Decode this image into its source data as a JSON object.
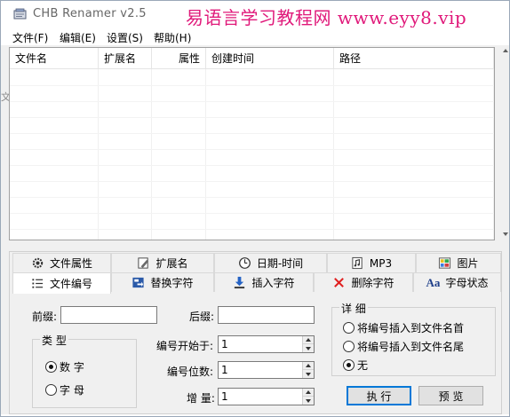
{
  "window": {
    "title": "CHB Renamer v2.5",
    "watermark": "易语言学习教程网 www.eyy8.vip"
  },
  "menu": [
    "文件(F)",
    "编辑(E)",
    "设置(S)",
    "帮助(H)"
  ],
  "list": {
    "columns": [
      "文件名",
      "扩展名",
      "属性",
      "创建时间",
      "路径"
    ],
    "rows": []
  },
  "stray_text": "文",
  "tabs": {
    "row1": [
      {
        "label": "文件属性",
        "icon": "gear-icon"
      },
      {
        "label": "扩展名",
        "icon": "edit-icon"
      },
      {
        "label": "日期-时间",
        "icon": "clock-icon"
      },
      {
        "label": "MP3",
        "icon": "music-file-icon"
      },
      {
        "label": "图片",
        "icon": "picture-icon"
      }
    ],
    "row2": [
      {
        "label": "文件编号",
        "icon": "numbered-list-icon",
        "active": true
      },
      {
        "label": "替换字符",
        "icon": "replace-icon"
      },
      {
        "label": "插入字符",
        "icon": "insert-arrow-icon"
      },
      {
        "label": "删除字符",
        "icon": "delete-x-icon"
      },
      {
        "label": "字母状态",
        "icon": "letter-case-icon",
        "icon_text": "Aa"
      }
    ]
  },
  "panel": {
    "prefix_label": "前缀:",
    "prefix_value": "",
    "suffix_label": "后缀:",
    "suffix_value": "",
    "type_group": "类 型",
    "type_options": [
      "数 字",
      "字 母"
    ],
    "type_selected": 0,
    "start_label": "编号开始于:",
    "start_value": "1",
    "digits_label": "编号位数:",
    "digits_value": "1",
    "increment_label": "增 量:",
    "increment_value": "1",
    "detail_group": "详 细",
    "detail_options": [
      "将编号插入到文件名首",
      "将编号插入到文件名尾",
      "无"
    ],
    "detail_selected": 2,
    "run_button": "执 行",
    "preview_button": "预 览"
  },
  "colors": {
    "watermark": "#e0197a",
    "default_button_border": "#0078d7",
    "delete_icon": "#e02020"
  }
}
